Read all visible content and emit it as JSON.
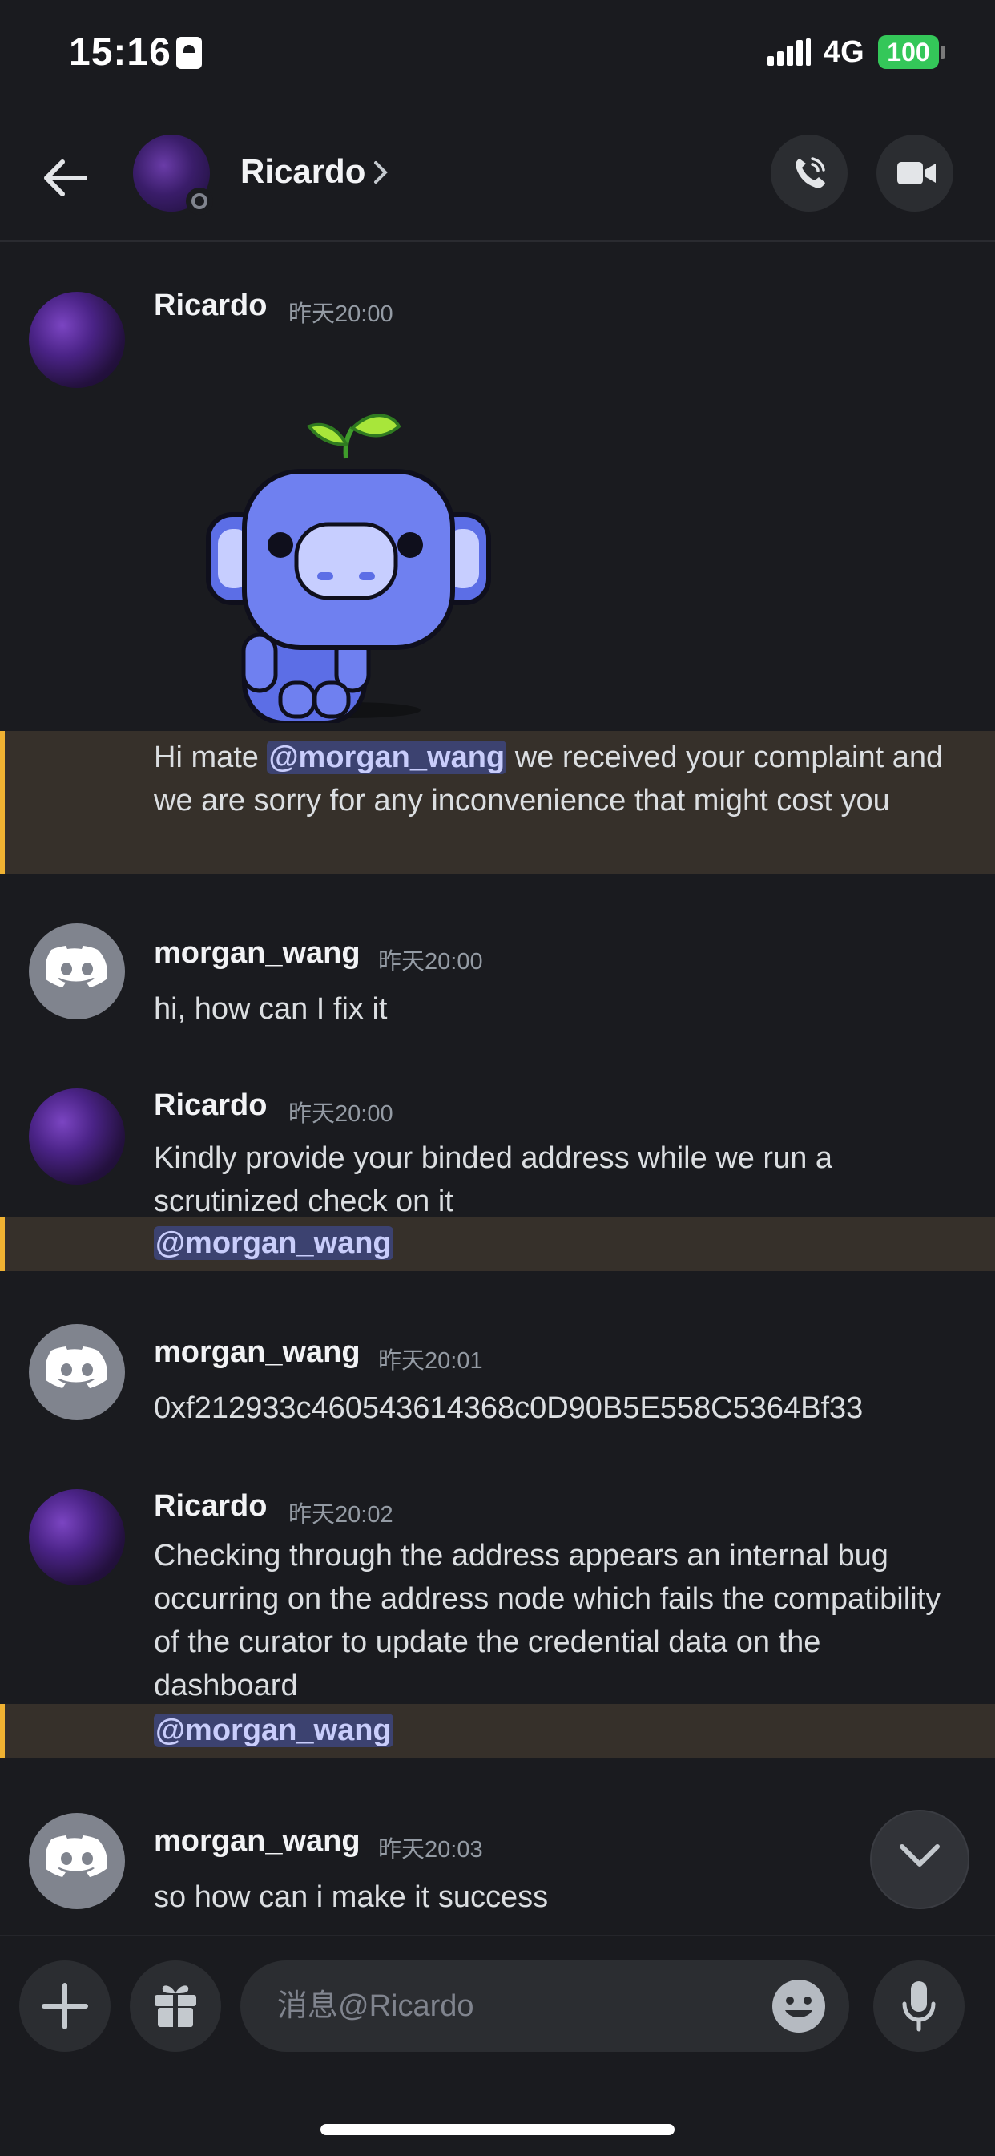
{
  "status_bar": {
    "time": "15:16",
    "network": "4G",
    "battery": "100"
  },
  "header": {
    "back_icon": "back-arrow-icon",
    "contact_name": "Ricardo",
    "call_icon": "phone-call-icon",
    "video_icon": "video-camera-icon"
  },
  "messages": [
    {
      "author": "Ricardo",
      "time": "昨天20:00",
      "sticker": "wumpus-sprout-sticker",
      "text_before": "Hi mate ",
      "mention": "@morgan_wang",
      "text_after": " we received your complaint and we are sorry for any inconvenience that might cost you"
    },
    {
      "author": "morgan_wang",
      "time": "昨天20:00",
      "text": "hi, how can I fix it"
    },
    {
      "author": "Ricardo",
      "time": "昨天20:00",
      "text": "Kindly provide your binded address while we run a scrutinized check on it",
      "mention": "@morgan_wang"
    },
    {
      "author": "morgan_wang",
      "time": "昨天20:01",
      "text": "0xf212933c460543614368c0D90B5E558C5364Bf33"
    },
    {
      "author": "Ricardo",
      "time": "昨天20:02",
      "text": "Checking through the address appears an internal bug occurring on the address node which fails the compatibility of the curator to update the credential data on the dashboard",
      "mention": "@morgan_wang"
    },
    {
      "author": "morgan_wang",
      "time": "昨天20:03",
      "text": "so how can i make it success"
    }
  ],
  "composer": {
    "placeholder": "消息@Ricardo",
    "plus_icon": "plus-icon",
    "gift_icon": "gift-icon",
    "emoji_icon": "emoji-icon",
    "mic_icon": "microphone-icon"
  },
  "colors": {
    "background": "#1a1b1f",
    "mention_highlight": "#36302a",
    "mention_bar": "#f0b232",
    "mention_pill": "#3c4270"
  }
}
